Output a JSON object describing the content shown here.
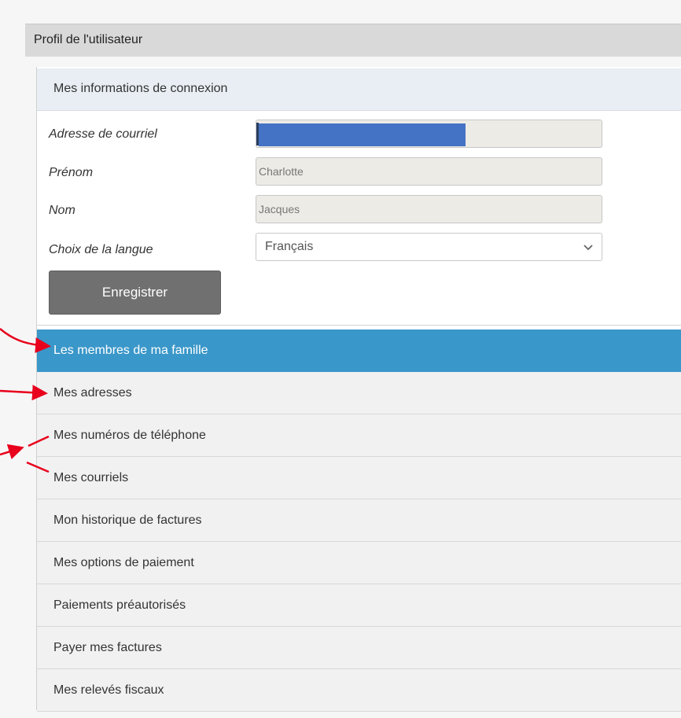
{
  "header": {
    "title": "Profil de l'utilisateur"
  },
  "login_section": {
    "title": "Mes informations de connexion",
    "fields": {
      "email": {
        "label": "Adresse de courriel",
        "value": ""
      },
      "first_name": {
        "label": "Prénom",
        "value": "Charlotte"
      },
      "last_name": {
        "label": "Nom",
        "value": "Jacques"
      },
      "language": {
        "label": "Choix de la langue",
        "selected": "Français"
      }
    },
    "save_label": "Enregistrer"
  },
  "nav": {
    "items": [
      {
        "label": "Les membres de ma famille",
        "active": true
      },
      {
        "label": "Mes adresses"
      },
      {
        "label": "Mes numéros de téléphone"
      },
      {
        "label": "Mes courriels"
      },
      {
        "label": "Mon historique de factures"
      },
      {
        "label": "Mes options de paiement"
      },
      {
        "label": "Paiements préautorisés"
      },
      {
        "label": "Payer mes factures"
      },
      {
        "label": "Mes relevés fiscaux"
      }
    ]
  },
  "colors": {
    "active_item": "#3a97c9",
    "redaction": "#4472c4",
    "annotation_arrow": "#e8001c",
    "save_button": "#707070"
  },
  "icons": {
    "language_select": "chevron-down-icon"
  }
}
